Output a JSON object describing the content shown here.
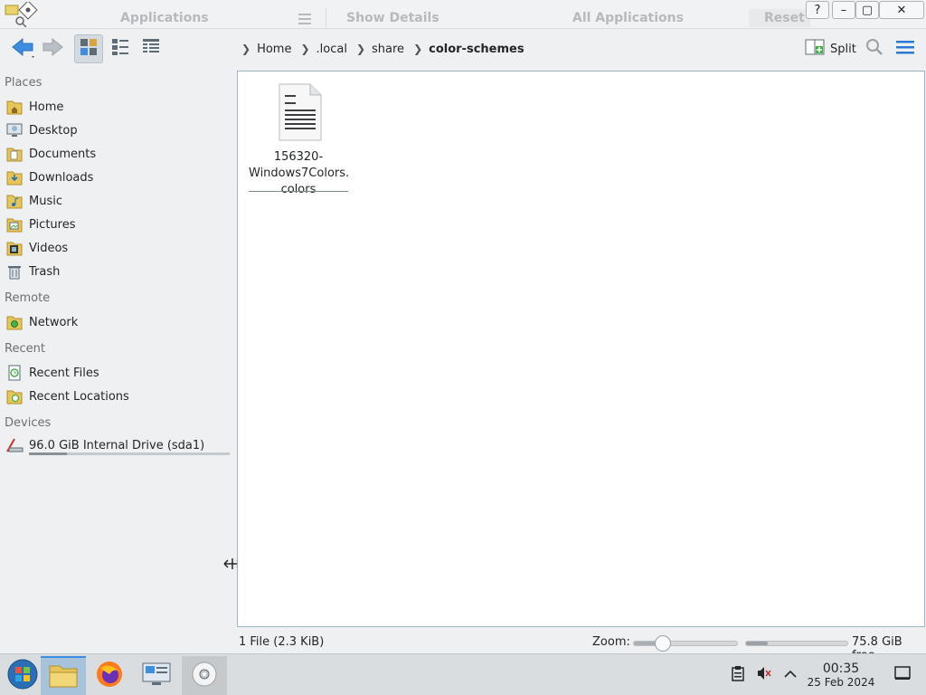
{
  "titlebar": {
    "ghost_left": "Applications",
    "ghost_center": "Show Details",
    "ghost_right": "All Applications",
    "ghost_reset": "Reset",
    "help": "?",
    "minimize": "–",
    "maximize": "▢",
    "close": "✕"
  },
  "toolbar": {
    "back_icon": "arrow-left-icon",
    "forward_icon": "arrow-right-icon",
    "views": [
      "icons-view",
      "compact-view",
      "details-view"
    ],
    "breadcrumb": [
      "Home",
      ".local",
      "share",
      "color-schemes"
    ],
    "split_label": "Split"
  },
  "sidebar": {
    "places_title": "Places",
    "places": [
      {
        "label": "Home",
        "icon": "home-folder-icon"
      },
      {
        "label": "Desktop",
        "icon": "desktop-icon"
      },
      {
        "label": "Documents",
        "icon": "documents-folder-icon"
      },
      {
        "label": "Downloads",
        "icon": "downloads-folder-icon"
      },
      {
        "label": "Music",
        "icon": "music-folder-icon"
      },
      {
        "label": "Pictures",
        "icon": "pictures-folder-icon"
      },
      {
        "label": "Videos",
        "icon": "videos-folder-icon"
      },
      {
        "label": "Trash",
        "icon": "trash-icon"
      }
    ],
    "remote_title": "Remote",
    "remote": [
      {
        "label": "Network",
        "icon": "network-folder-icon"
      }
    ],
    "recent_title": "Recent",
    "recent": [
      {
        "label": "Recent Files",
        "icon": "recent-files-icon"
      },
      {
        "label": "Recent Locations",
        "icon": "recent-locations-icon"
      }
    ],
    "devices_title": "Devices",
    "devices": [
      {
        "label": "96.0 GiB Internal Drive (sda1)",
        "icon": "drive-icon",
        "used_fraction": 0.19
      }
    ]
  },
  "view": {
    "files": [
      {
        "name_lines": [
          "156320-",
          "Windows7Colors.",
          "colors"
        ],
        "icon": "text-document-icon"
      }
    ]
  },
  "status": {
    "summary": "1 File (2.3 KiB)",
    "zoom_label": "Zoom:",
    "zoom_fraction": 0.28,
    "free_fraction": 0.21,
    "free_text": "75.8 GiB free"
  },
  "taskbar": {
    "tasks": [
      "start-menu-icon",
      "file-manager-icon",
      "firefox-icon",
      "system-settings-icon",
      "disc-icon"
    ],
    "clock_time": "00:35",
    "clock_date": "25 Feb 2024"
  },
  "colors": {
    "accent": "#3d8ee0",
    "view_border": "#9ab8c8",
    "window_bg": "#eff0f1"
  }
}
